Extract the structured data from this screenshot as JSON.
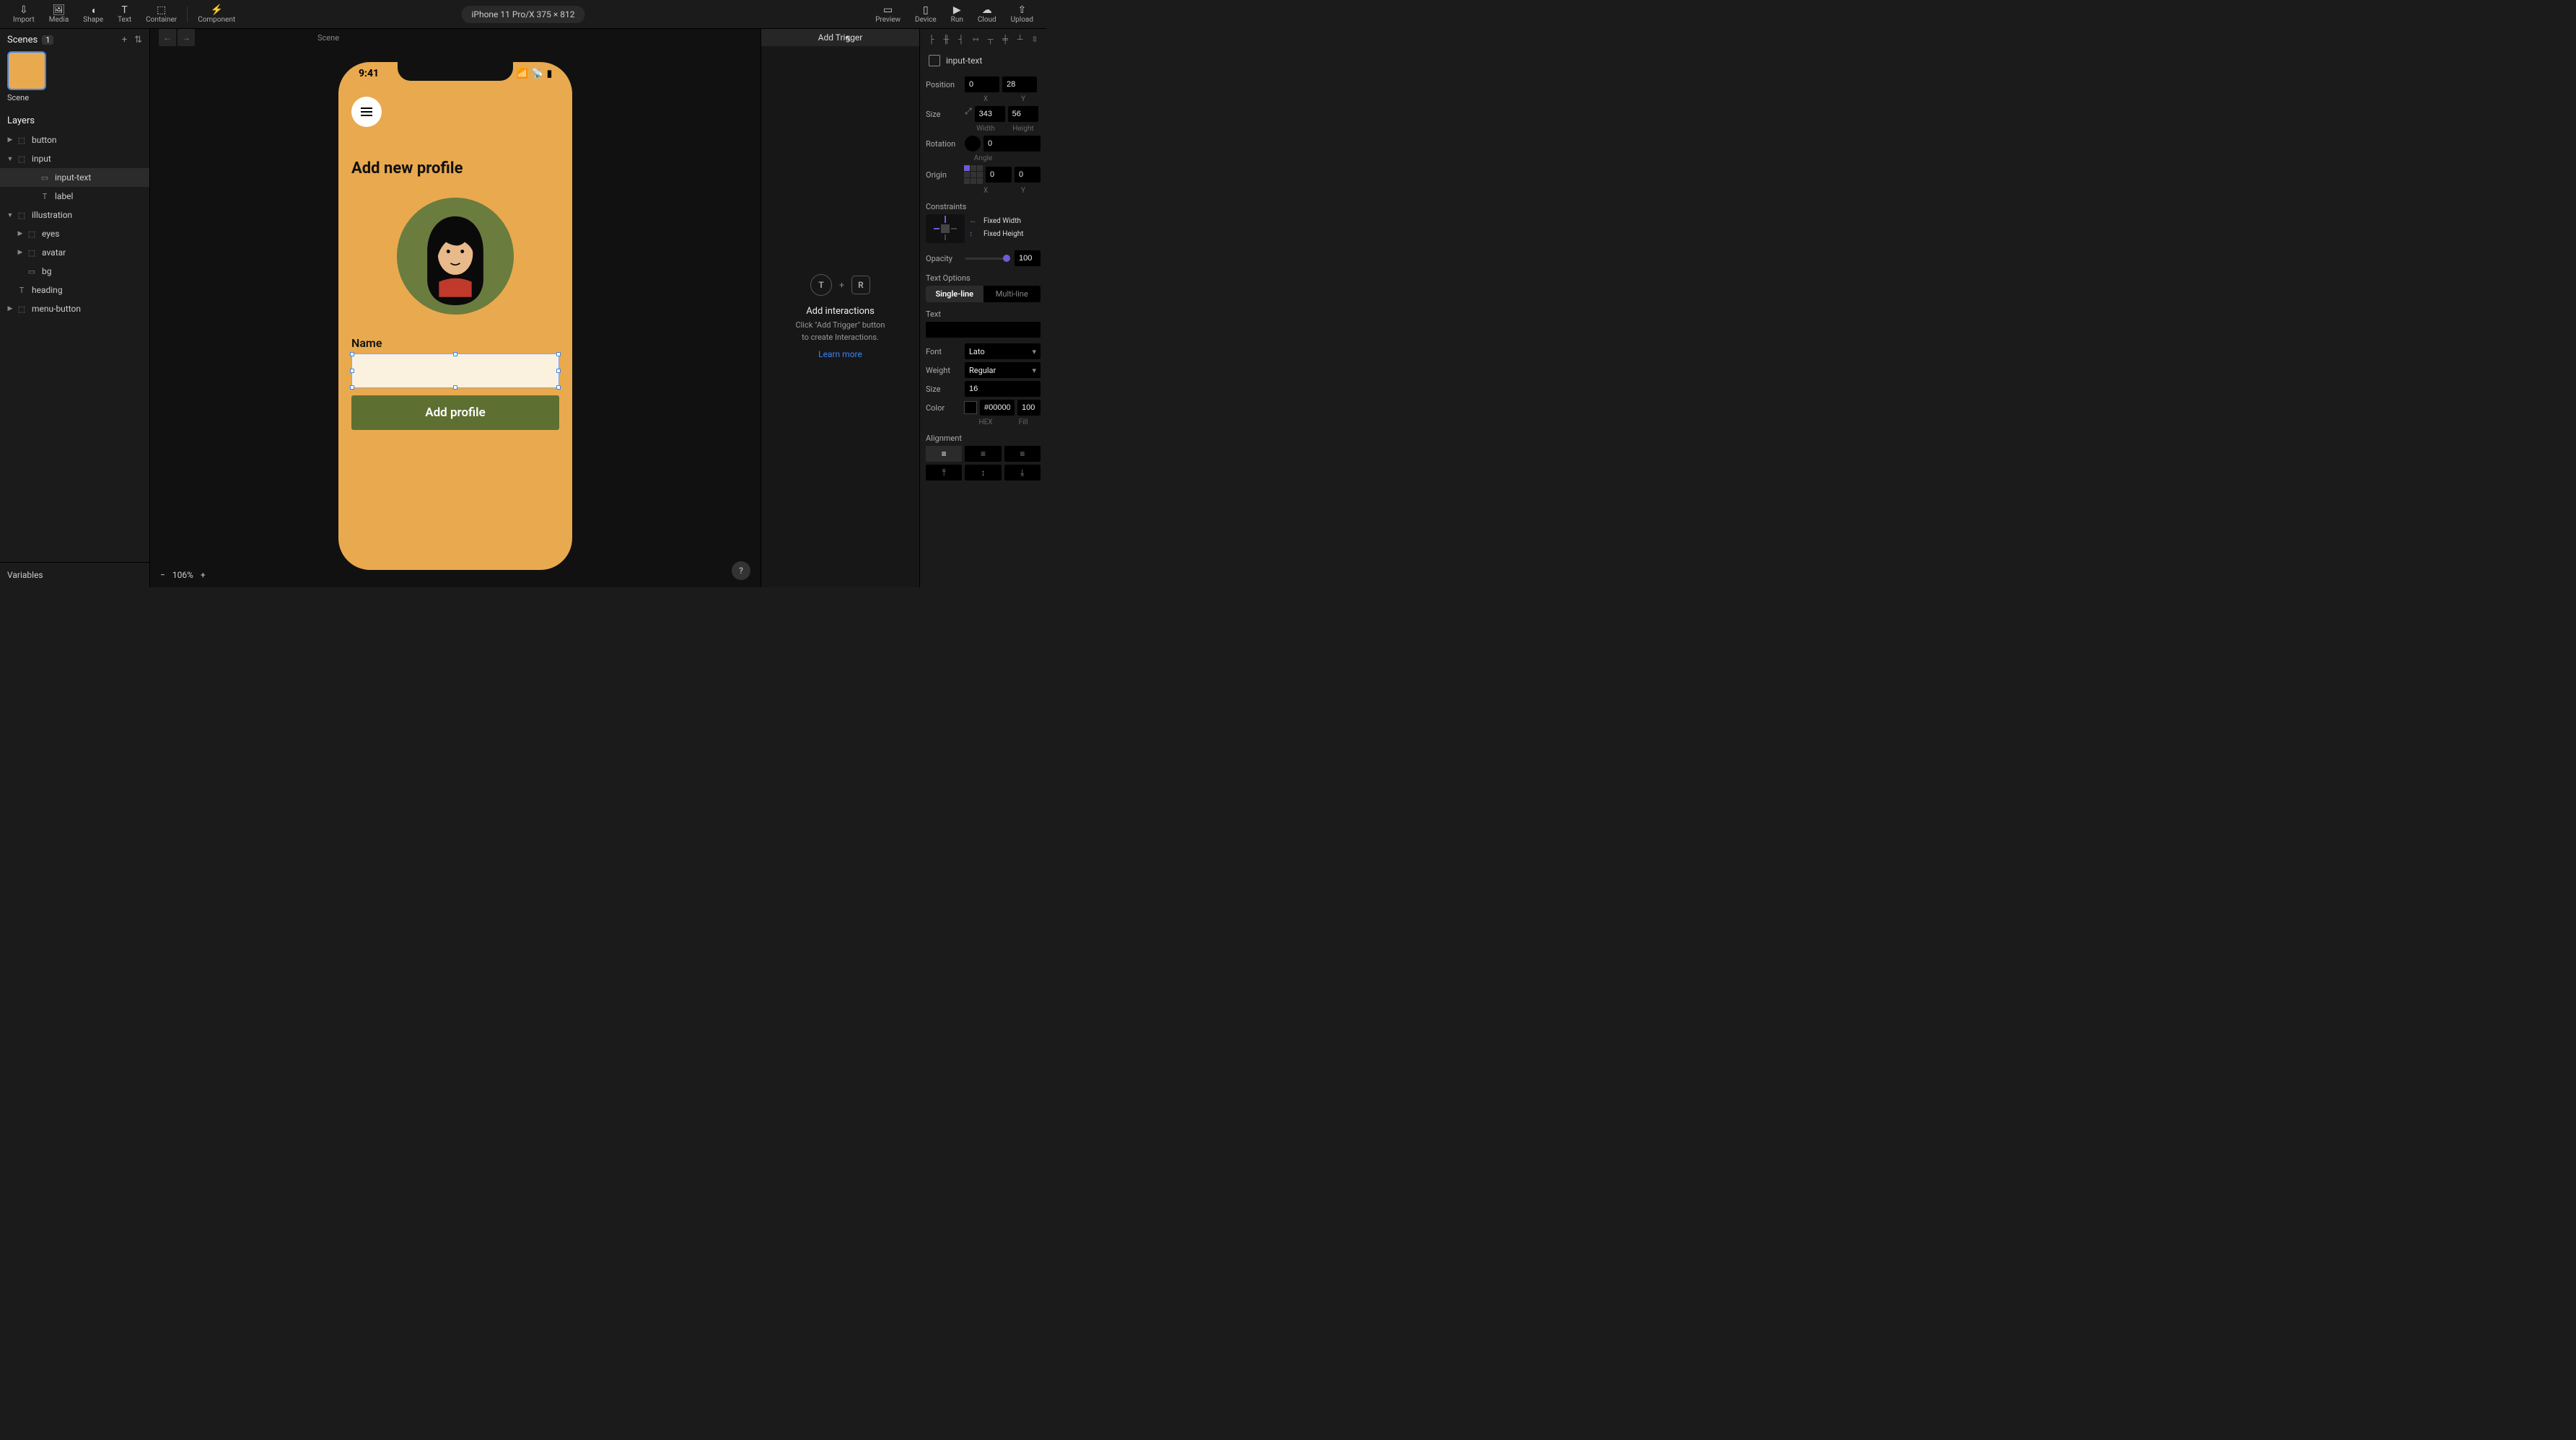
{
  "toolbar": {
    "import": "Import",
    "media": "Media",
    "shape": "Shape",
    "text": "Text",
    "container": "Container",
    "component": "Component",
    "preview": "Preview",
    "device": "Device",
    "run": "Run",
    "cloud": "Cloud",
    "upload": "Upload"
  },
  "device_info": "iPhone 11 Pro/X  375 × 812",
  "scenes": {
    "title": "Scenes",
    "count": "1",
    "item": "Scene"
  },
  "layers": {
    "title": "Layers",
    "items": [
      {
        "name": "button",
        "indent": 0,
        "caret": "▶",
        "icon": "⬚"
      },
      {
        "name": "input",
        "indent": 0,
        "caret": "▼",
        "icon": "⬚"
      },
      {
        "name": "input-text",
        "indent": 2,
        "caret": "",
        "icon": "▭",
        "selected": true
      },
      {
        "name": "label",
        "indent": 2,
        "caret": "",
        "icon": "T"
      },
      {
        "name": "illustration",
        "indent": 0,
        "caret": "▼",
        "icon": "⬚"
      },
      {
        "name": "eyes",
        "indent": 1,
        "caret": "▶",
        "icon": "⬚"
      },
      {
        "name": "avatar",
        "indent": 1,
        "caret": "▶",
        "icon": "⬚"
      },
      {
        "name": "bg",
        "indent": 1,
        "caret": "",
        "icon": "▭"
      },
      {
        "name": "heading",
        "indent": 0,
        "caret": "",
        "icon": "T"
      },
      {
        "name": "menu-button",
        "indent": 0,
        "caret": "▶",
        "icon": "⬚"
      }
    ]
  },
  "variables_title": "Variables",
  "canvas": {
    "scene_label": "Scene",
    "time": "9:41",
    "heading": "Add new profile",
    "name_label": "Name",
    "button_label": "Add profile",
    "zoom": "106%"
  },
  "interactions": {
    "add_trigger": "Add Trigger",
    "title": "Add interactions",
    "desc1": "Click \"Add Trigger\" button",
    "desc2": "to create Interactions.",
    "learn": "Learn more",
    "t": "T",
    "r": "R"
  },
  "inspector": {
    "selected": "input-text",
    "position": {
      "label": "Position",
      "x": "0",
      "y": "28",
      "xl": "X",
      "yl": "Y"
    },
    "size": {
      "label": "Size",
      "w": "343",
      "h": "56",
      "wl": "Width",
      "hl": "Height"
    },
    "rotation": {
      "label": "Rotation",
      "v": "0",
      "al": "Angle"
    },
    "origin": {
      "label": "Origin",
      "x": "0",
      "y": "0",
      "xl": "X",
      "yl": "Y"
    },
    "constraints": {
      "label": "Constraints",
      "fw": "Fixed Width",
      "fh": "Fixed Height"
    },
    "opacity": {
      "label": "Opacity",
      "v": "100"
    },
    "text_options": "Text Options",
    "single": "Single-line",
    "multi": "Multi-line",
    "text_label": "Text",
    "font": {
      "label": "Font",
      "v": "Lato"
    },
    "weight": {
      "label": "Weight",
      "v": "Regular"
    },
    "fsize": {
      "label": "Size",
      "v": "16"
    },
    "color": {
      "label": "Color",
      "hex": "#000000",
      "fill": "100",
      "hl": "HEX",
      "fl": "Fill"
    },
    "alignment": "Alignment"
  }
}
